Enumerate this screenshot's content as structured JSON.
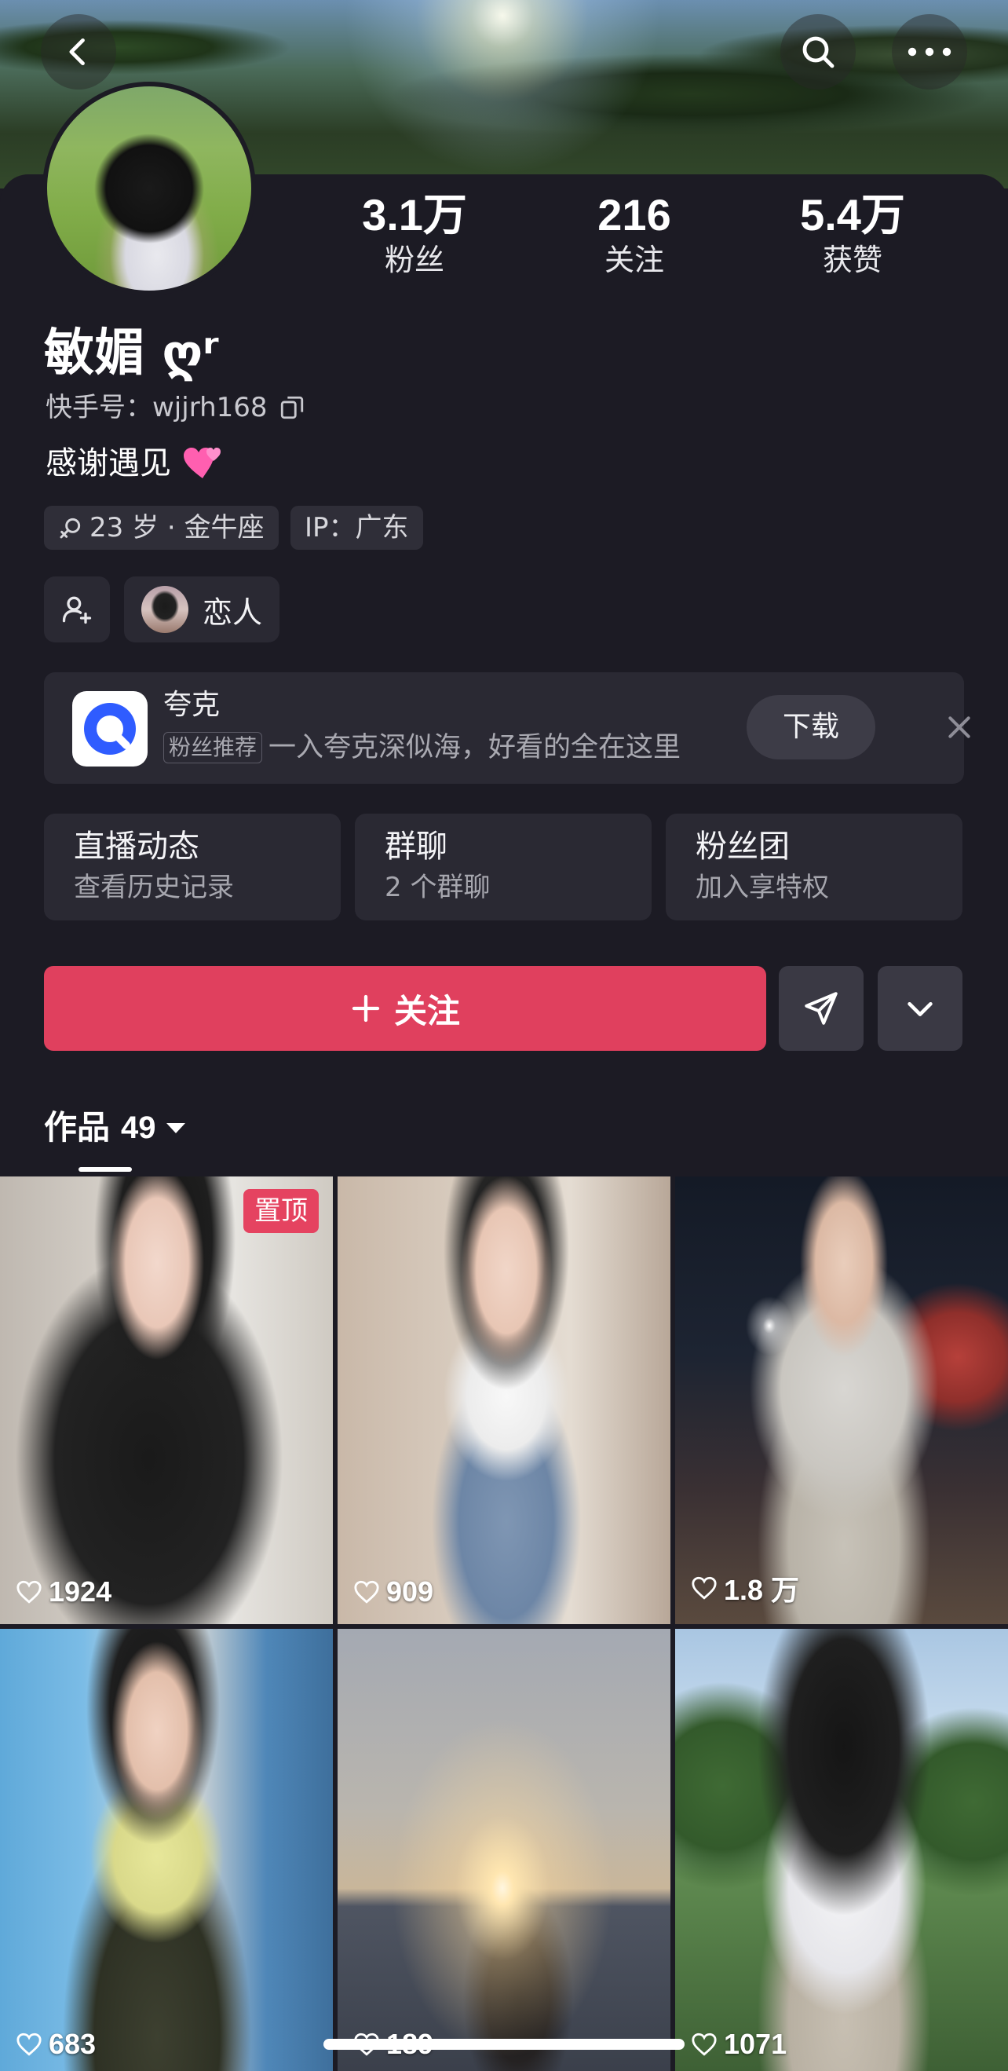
{
  "profile": {
    "name": "敏媚 ღʳ",
    "kuaishou_id": "快手号：wjjrh168",
    "bio": "感谢遇见",
    "stats": [
      {
        "value": "3.1万",
        "label": "粉丝"
      },
      {
        "value": "216",
        "label": "关注"
      },
      {
        "value": "5.4万",
        "label": "获赞"
      }
    ],
    "tags": [
      "23 岁 · 金牛座",
      "IP：广东"
    ],
    "relation_chip": "恋人"
  },
  "ad": {
    "app_name": "夸克",
    "badge": "粉丝推荐",
    "description": "一入夸克深似海，好看的全在这里",
    "download_label": "下载"
  },
  "features": [
    {
      "title": "直播动态",
      "subtitle": "查看历史记录"
    },
    {
      "title": "群聊",
      "subtitle": "2 个群聊"
    },
    {
      "title": "粉丝团",
      "subtitle": "加入享特权"
    }
  ],
  "actions": {
    "follow_label": "关注"
  },
  "works": {
    "label": "作品",
    "count": "49",
    "pinned_label": "置顶",
    "items": [
      {
        "likes": "1924"
      },
      {
        "likes": "909"
      },
      {
        "likes": "1.8 万"
      },
      {
        "likes": "683"
      },
      {
        "likes": "189"
      },
      {
        "likes": "1071"
      }
    ]
  },
  "colors": {
    "background": "#1c1b24",
    "card": "#2a2933",
    "accent": "#e0405e"
  }
}
